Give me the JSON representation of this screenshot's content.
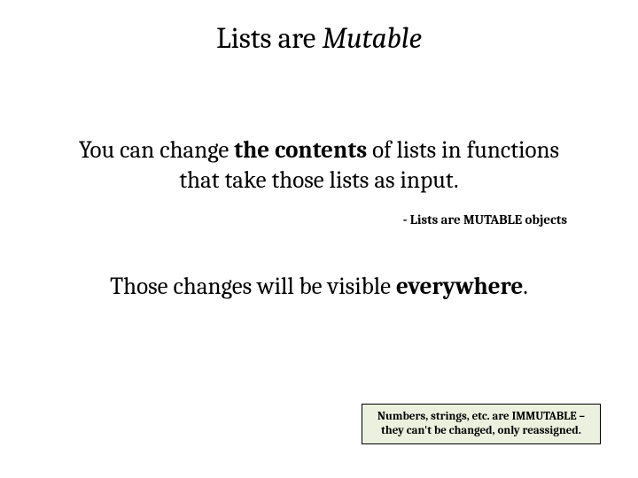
{
  "title": {
    "prefix": "Lists are ",
    "italic": "Mutable"
  },
  "para1": {
    "pre": "You can change ",
    "bold": "the contents",
    "post": " of lists in functions that take those lists as input."
  },
  "bullet_note": "-  Lists are MUTABLE objects",
  "para2": {
    "pre": "Those changes will be visible ",
    "bold": "everywhere",
    "post": "."
  },
  "callout": "Numbers, strings, etc. are IMMUTABLE – they can't be changed, only reassigned."
}
